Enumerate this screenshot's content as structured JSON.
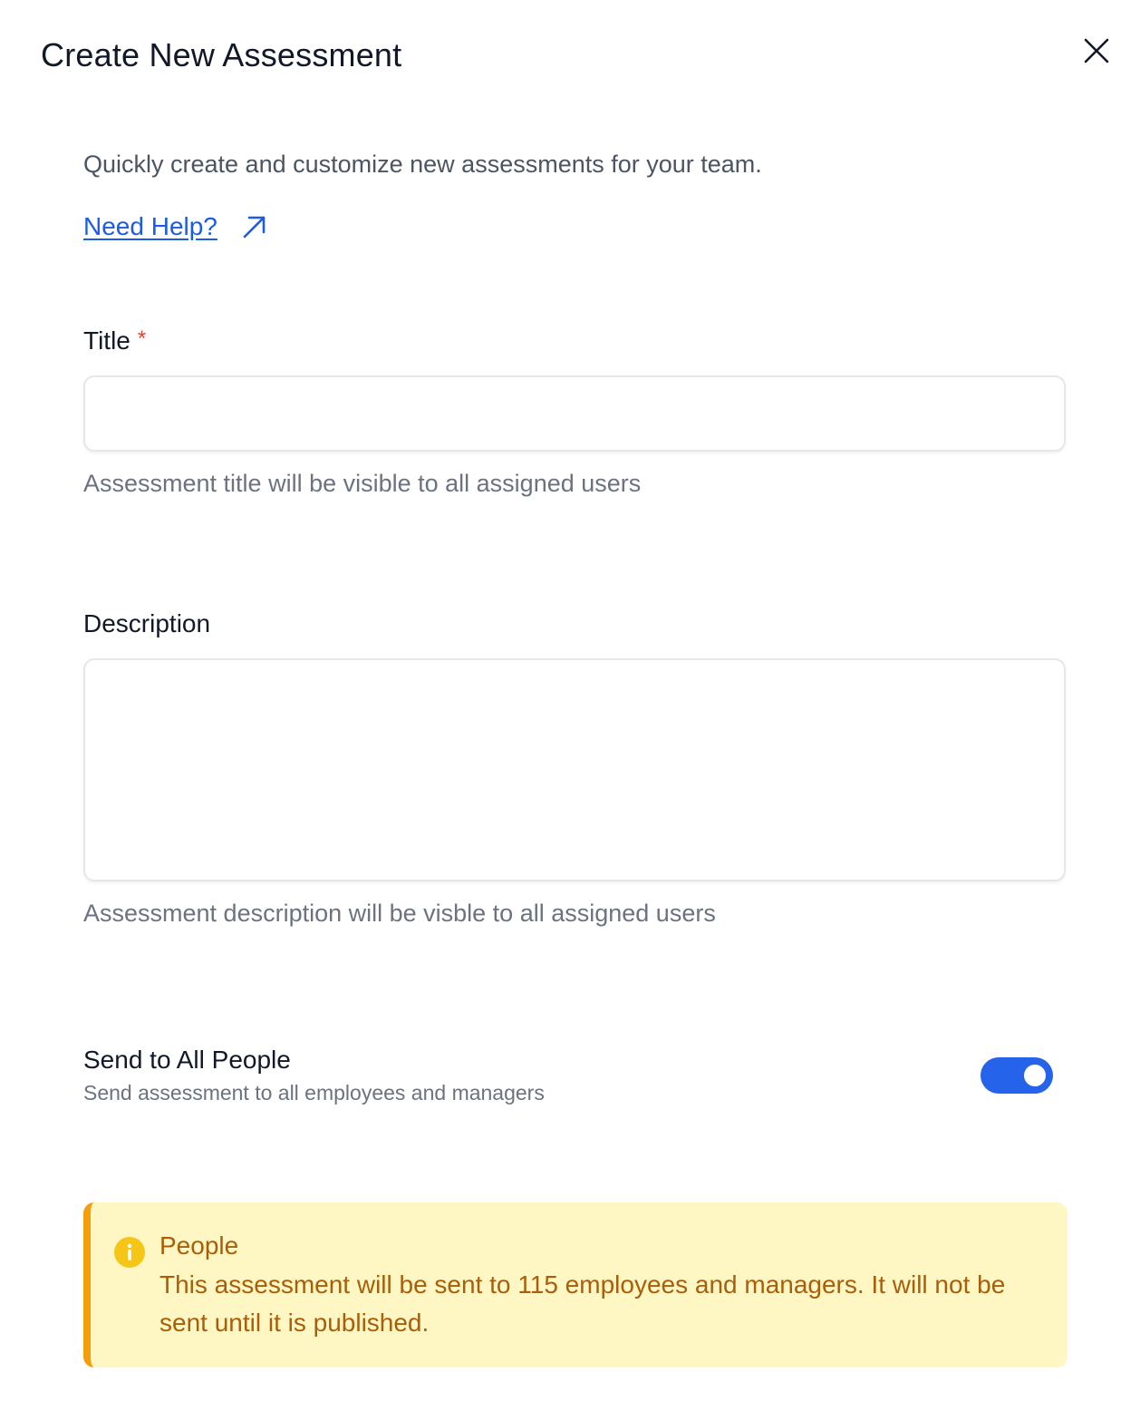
{
  "modal": {
    "title": "Create New Assessment",
    "close_icon": "close-icon"
  },
  "intro": {
    "text": "Quickly create and customize new assessments for your team.",
    "help_link": "Need Help?",
    "help_icon": "external-link-icon"
  },
  "title_field": {
    "label": "Title",
    "required_marker": "*",
    "value": "",
    "placeholder": "",
    "hint": "Assessment title will be visible to all assigned users"
  },
  "description_field": {
    "label": "Description",
    "value": "",
    "placeholder": "",
    "hint": "Assessment description will be visble to all assigned users"
  },
  "send_to_all": {
    "label": "Send to All People",
    "description": "Send assessment to all employees and managers",
    "enabled": true
  },
  "alert": {
    "icon": "info-icon",
    "title": "People",
    "body": "This assessment will be sent to 115 employees and managers. It will not be sent until it is published."
  },
  "colors": {
    "accent": "#2563eb",
    "link": "#1d5be6",
    "required": "#e0452f",
    "alert_bg": "#fef7c3",
    "alert_border": "#f59e0b",
    "alert_text": "#a85e0a",
    "info_icon": "#f5c518"
  }
}
